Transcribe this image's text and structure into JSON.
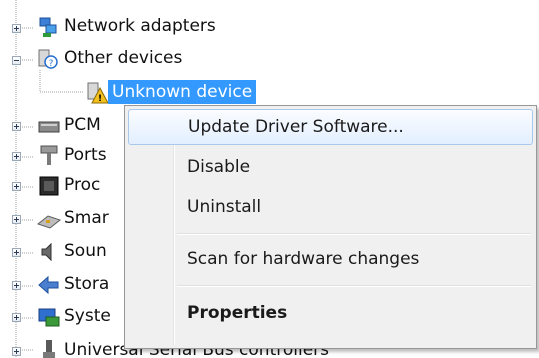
{
  "tree": {
    "items": [
      {
        "label": "Network adapters",
        "icon": "network-adapter-icon",
        "expander": "plus"
      },
      {
        "label": "Other devices",
        "icon": "other-devices-icon",
        "expander": "minus"
      },
      {
        "label": "Unknown device",
        "icon": "unknown-device-warning-icon",
        "selected": true
      },
      {
        "label": "PCM",
        "icon": "pcmcia-icon",
        "expander": "plus"
      },
      {
        "label": "Ports",
        "icon": "ports-icon",
        "expander": "plus"
      },
      {
        "label": "Proc",
        "icon": "processor-icon",
        "expander": "plus"
      },
      {
        "label": "Smar",
        "icon": "smart-card-icon",
        "expander": "plus"
      },
      {
        "label": "Soun",
        "icon": "sound-icon",
        "expander": "plus"
      },
      {
        "label": "Stora",
        "icon": "storage-icon",
        "expander": "plus"
      },
      {
        "label": "Syste",
        "icon": "system-devices-icon",
        "expander": "plus"
      },
      {
        "label": "Universal Serial Bus controllers",
        "icon": "usb-icon",
        "expander": "plus"
      }
    ]
  },
  "context_menu": {
    "items": [
      {
        "label": "Update Driver Software...",
        "highlighted": true,
        "bold": false
      },
      {
        "label": "Disable",
        "highlighted": false,
        "bold": false
      },
      {
        "label": "Uninstall",
        "highlighted": false,
        "bold": false
      },
      {
        "label": "Scan for hardware changes",
        "highlighted": false,
        "bold": false
      },
      {
        "label": "Properties",
        "highlighted": false,
        "bold": true
      }
    ]
  },
  "colors": {
    "selection": "#3399ff",
    "menu_background": "#f0f0f0",
    "menu_hover": "#e3efff"
  }
}
